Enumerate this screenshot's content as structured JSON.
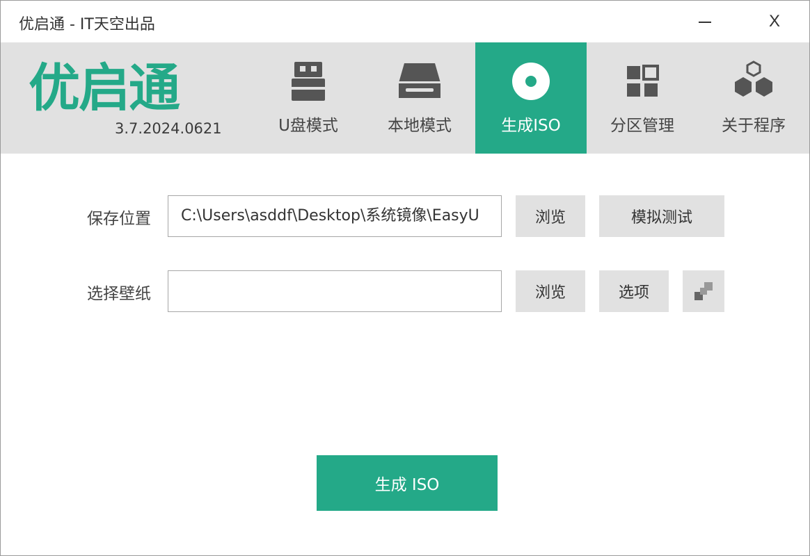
{
  "window": {
    "title": "优启通 - IT天空出品",
    "minimize_glyph": "—",
    "close_glyph": "X"
  },
  "header": {
    "logo_text": "优启通",
    "version": "3.7.2024.0621",
    "tabs": [
      {
        "label": "U盘模式",
        "icon": "usb-drive-icon",
        "active": false
      },
      {
        "label": "本地模式",
        "icon": "hard-disk-icon",
        "active": false
      },
      {
        "label": "生成ISO",
        "icon": "disc-icon",
        "active": true
      },
      {
        "label": "分区管理",
        "icon": "partition-grid-icon",
        "active": false
      },
      {
        "label": "关于程序",
        "icon": "hexagons-icon",
        "active": false
      }
    ]
  },
  "form": {
    "save_location": {
      "label": "保存位置",
      "value": "C:\\Users\\asddf\\Desktop\\系统镜像\\EasyU",
      "browse_label": "浏览",
      "simulate_label": "模拟测试"
    },
    "wallpaper": {
      "label": "选择壁纸",
      "value": "",
      "browse_label": "浏览",
      "options_label": "选项"
    }
  },
  "actions": {
    "generate_label": "生成 ISO"
  },
  "colors": {
    "accent": "#24a988",
    "header_bg": "#e1e1e1",
    "button_bg": "#e1e1e1"
  }
}
